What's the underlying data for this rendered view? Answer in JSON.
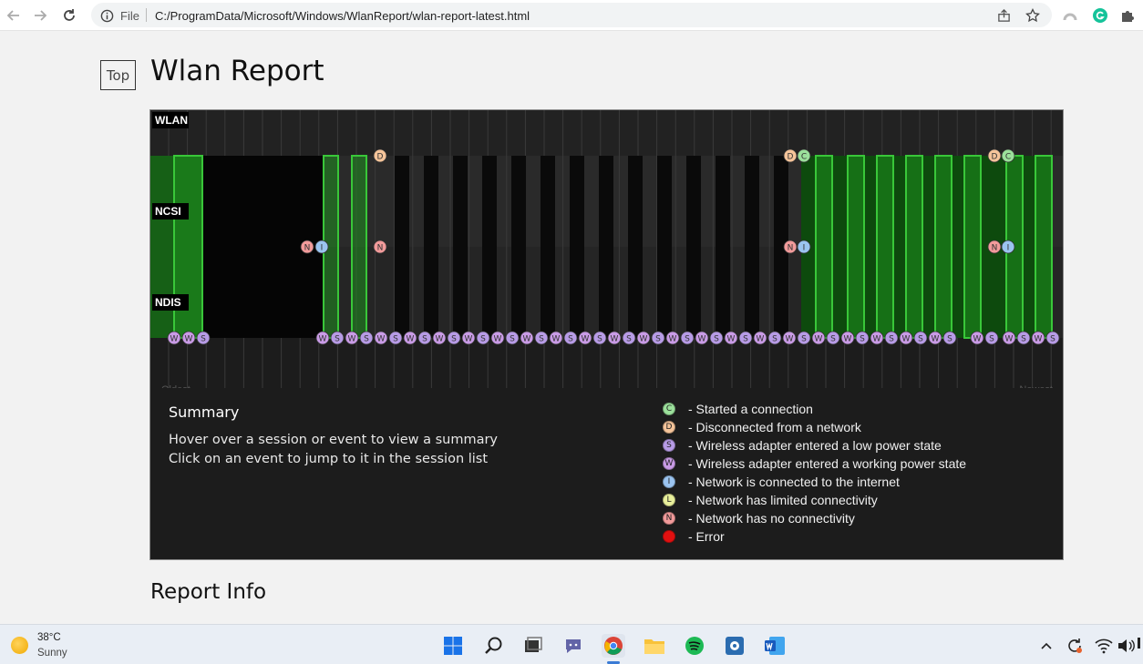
{
  "browser": {
    "omnibox_label": "File",
    "url": "C:/ProgramData/Microsoft/Windows/WlanReport/wlan-report-latest.html"
  },
  "page": {
    "top_link": "Top",
    "title": "Wlan Report",
    "report_info_heading": "Report Info"
  },
  "chart": {
    "row_labels": [
      "WLAN",
      "NCSI",
      "NDIS"
    ],
    "axis_left": "Oldest",
    "axis_right": "Newest",
    "event_letters": {
      "started": "C",
      "disconnected": "D",
      "low_power": "S",
      "working_power": "W",
      "internet": "I",
      "limited": "L",
      "no_connectivity": "N"
    },
    "colors": {
      "panel_bg": "#1c1c1c",
      "session_green": "#1f8f1f",
      "session_green_border": "#39c739",
      "c": "#9be09b",
      "d": "#f5c49a",
      "s": "#b79be6",
      "w": "#c99be6",
      "i": "#9bc4f0",
      "l": "#e8ef9b",
      "n": "#f29b9b",
      "error": "#e11010"
    }
  },
  "summary": {
    "title": "Summary",
    "line1": "Hover over a session or event to view a summary",
    "line2": "Click on an event to jump to it in the session list"
  },
  "legend": [
    {
      "letter": "C",
      "text": "- Started a connection",
      "color": "#9be09b"
    },
    {
      "letter": "D",
      "text": "- Disconnected from a network",
      "color": "#f5c49a"
    },
    {
      "letter": "S",
      "text": "- Wireless adapter entered a low power state",
      "color": "#b79be6"
    },
    {
      "letter": "W",
      "text": "- Wireless adapter entered a working power state",
      "color": "#c99be6"
    },
    {
      "letter": "I",
      "text": "- Network is connected to the internet",
      "color": "#9bc4f0"
    },
    {
      "letter": "L",
      "text": "- Network has limited connectivity",
      "color": "#e8ef9b"
    },
    {
      "letter": "N",
      "text": "- Network has no connectivity",
      "color": "#f29b9b"
    },
    {
      "letter": "",
      "text": "- Error",
      "color": "#e11010"
    }
  ],
  "taskbar": {
    "weather_temp": "38°C",
    "weather_desc": "Sunny"
  }
}
